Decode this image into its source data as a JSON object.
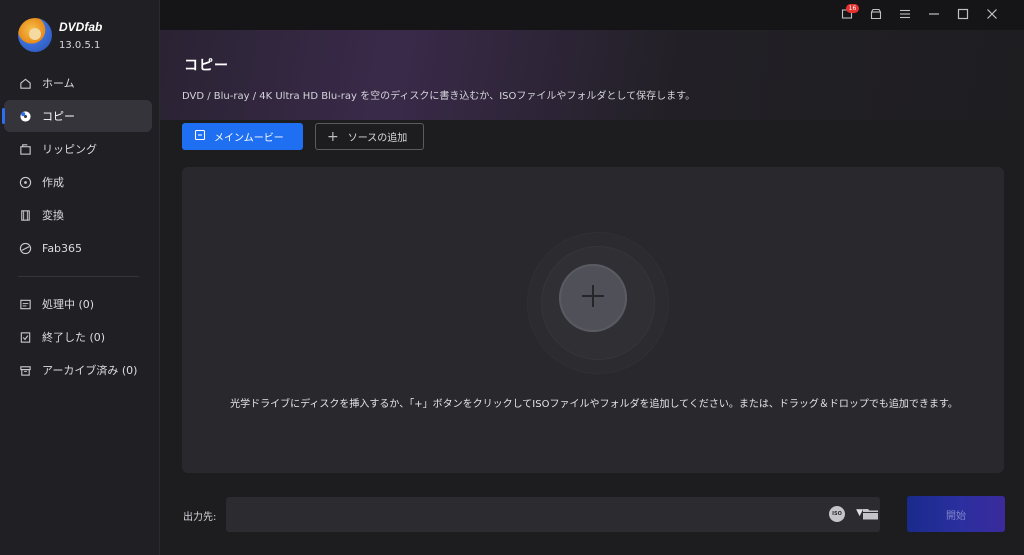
{
  "app": {
    "name": "DVDfab",
    "version": "13.0.5.1"
  },
  "titlebar": {
    "notification_count": "16"
  },
  "sidebar": {
    "items": [
      {
        "label": "ホーム",
        "icon": "home-icon"
      },
      {
        "label": "コピー",
        "icon": "disc-copy-icon",
        "active": true
      },
      {
        "label": "リッピング",
        "icon": "ripping-icon"
      },
      {
        "label": "作成",
        "icon": "create-disc-icon"
      },
      {
        "label": "変換",
        "icon": "film-convert-icon"
      },
      {
        "label": "Fab365",
        "icon": "fab365-icon"
      }
    ],
    "queue": [
      {
        "label": "処理中 (0)",
        "icon": "processing-icon"
      },
      {
        "label": "終了した (0)",
        "icon": "finished-icon"
      },
      {
        "label": "アーカイブ済み (0)",
        "icon": "archive-icon"
      }
    ]
  },
  "main": {
    "title": "コピー",
    "description": "DVD / Blu-ray / 4K Ultra HD Blu-ray を空のディスクに書き込むか、ISOファイルやフォルダとして保存します。",
    "main_copy_label": "メインムービー",
    "add_source_label": "ソースの追加",
    "drop_hint": "光学ドライブにディスクを挿入するか、「+」ボタンをクリックしてISOファイルやフォルダを追加してください。または、ドラッグ＆ドロップでも追加できます。",
    "output_label": "出力先:",
    "output_value": "",
    "iso_label": "ISO",
    "start_label": "開始"
  },
  "colors": {
    "accent": "#1f6ff2",
    "badge": "#e5322f",
    "background": "#1d1d20",
    "sidebar": "#202024"
  }
}
